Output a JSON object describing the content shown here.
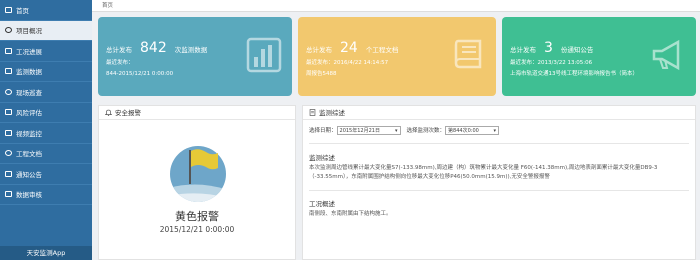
{
  "sidebar": {
    "items": [
      {
        "label": "首页",
        "icon": "home-icon"
      },
      {
        "label": "项目概况",
        "icon": "folder-icon"
      },
      {
        "label": "工况进展",
        "icon": "list-icon"
      },
      {
        "label": "监测数据",
        "icon": "table-icon"
      },
      {
        "label": "现场巡查",
        "icon": "eye-icon"
      },
      {
        "label": "风险评估",
        "icon": "warning-icon"
      },
      {
        "label": "视频监控",
        "icon": "video-icon"
      },
      {
        "label": "工程文档",
        "icon": "document-icon"
      },
      {
        "label": "通知公告",
        "icon": "megaphone-icon"
      },
      {
        "label": "数据审核",
        "icon": "check-icon"
      }
    ],
    "active_index": 1,
    "footer": "天安监测App"
  },
  "breadcrumb": "首页",
  "cards": [
    {
      "label": "总计发布",
      "number": "842",
      "unit": "次监测数据",
      "line1": "最近发布：",
      "line2": "844-2015/12/21 0:00:00",
      "color": "#5aa9bd",
      "icon": "bar-chart-icon"
    },
    {
      "label": "总计发布",
      "number": "24",
      "unit": "个工程文档",
      "line1": "最近发布：2016/4/22 14:14:57",
      "line2": "周报告5488",
      "color": "#f2c86e",
      "icon": "book-icon"
    },
    {
      "label": "总计发布",
      "number": "3",
      "unit": "份通知公告",
      "line1": "最近发布：2013/3/22 13:05:06",
      "line2": "上海市轨道交通13号线工程环境影响报告书（简本）",
      "color": "#3fbf93",
      "icon": "megaphone-icon"
    }
  ],
  "alert_panel": {
    "title": "安全报警",
    "level": "黄色报警",
    "time": "2015/12/21 0:00:00",
    "flag_color": "#e6c937",
    "circle_color": "#6ea6c9"
  },
  "report_panel": {
    "title": "监测综述",
    "date_label": "选择日期：",
    "date_value": "2015年12月21日",
    "count_label": "选择监测次数：",
    "count_value": "第844次0:00",
    "summary_title": "监测综述",
    "summary_text": "本次监测周边管线累计最大变化量S7(-133.98mm),周边建（构）筑物累计最大变化量 F60(-141.38mm),周边地表剖面累计最大变化量DB9-3（-33.55mm），东南附属围护结构侧向位移最大变化位移P46(50.0mm(15.9m)),无安全警报报警",
    "work_title": "工况概述",
    "work_text": "南侧段、东南附属由下结构施工。"
  }
}
